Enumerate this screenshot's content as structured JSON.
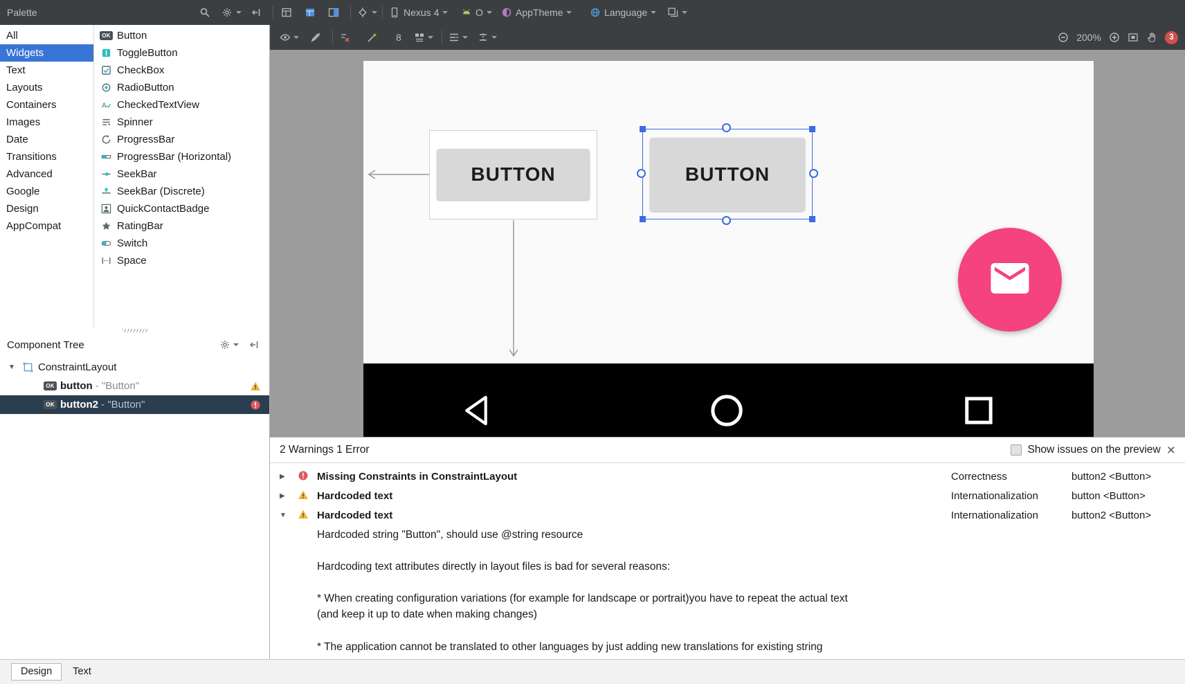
{
  "top_toolbar": {
    "palette_label": "Palette",
    "device_label": "Nexus 4",
    "api_label": "O",
    "theme_label": "AppTheme",
    "language_label": "Language"
  },
  "design_toolbar": {
    "default_margin": "8",
    "zoom_level": "200%",
    "issue_count": "3"
  },
  "palette": {
    "categories": [
      {
        "label": "All"
      },
      {
        "label": "Widgets"
      },
      {
        "label": "Text"
      },
      {
        "label": "Layouts"
      },
      {
        "label": "Containers"
      },
      {
        "label": "Images"
      },
      {
        "label": "Date"
      },
      {
        "label": "Transitions"
      },
      {
        "label": "Advanced"
      },
      {
        "label": "Google"
      },
      {
        "label": "Design"
      },
      {
        "label": "AppCompat"
      }
    ],
    "widgets": [
      {
        "label": "Button"
      },
      {
        "label": "ToggleButton"
      },
      {
        "label": "CheckBox"
      },
      {
        "label": "RadioButton"
      },
      {
        "label": "CheckedTextView"
      },
      {
        "label": "Spinner"
      },
      {
        "label": "ProgressBar"
      },
      {
        "label": "ProgressBar (Horizontal)"
      },
      {
        "label": "SeekBar"
      },
      {
        "label": "SeekBar (Discrete)"
      },
      {
        "label": "QuickContactBadge"
      },
      {
        "label": "RatingBar"
      },
      {
        "label": "Switch"
      },
      {
        "label": "Space"
      }
    ]
  },
  "component_tree": {
    "title": "Component Tree",
    "nodes": [
      {
        "name": "ConstraintLayout",
        "suffix": ""
      },
      {
        "name": "button",
        "suffix": " - \"Button\""
      },
      {
        "name": "button2",
        "suffix": " - \"Button\""
      }
    ]
  },
  "canvas": {
    "button1_label": "BUTTON",
    "button2_label": "BUTTON"
  },
  "issues": {
    "summary": "2 Warnings 1 Error",
    "show_on_preview_label": "Show issues on the preview",
    "rows": [
      {
        "title": "Missing Constraints in ConstraintLayout",
        "category": "Correctness",
        "component": "button2 <Button>"
      },
      {
        "title": "Hardcoded text",
        "category": "Internationalization",
        "component": "button <Button>"
      },
      {
        "title": "Hardcoded text",
        "category": "Internationalization",
        "component": "button2 <Button>"
      }
    ],
    "detail": {
      "line1": "Hardcoded string \"Button\", should use @string resource",
      "line2": "Hardcoding text attributes directly in layout files is bad for several reasons:",
      "line3a": "* When creating configuration variations (for example for landscape or portrait)you have to repeat the actual text",
      "line3b": "(and keep it up to date when making changes)",
      "line4": "* The application cannot be translated to other languages by just adding new translations for existing string"
    }
  },
  "bottom_tabs": [
    {
      "label": "Design"
    },
    {
      "label": "Text"
    }
  ],
  "icons": {
    "ok_badge": "OK",
    "expand_open_glyph": "▼",
    "expand_closed_glyph": "▶",
    "close_glyph": "×",
    "letter_a_glyph": "A"
  },
  "colors": {
    "toolbar_bg": "#3c3f41",
    "selection_blue": "#3875d6",
    "constraint_blue": "#3d6be4",
    "fab_pink": "#f4437f",
    "error_red": "#dd5a62",
    "warning_yellow": "#f2b63c",
    "canvas_gray": "#9c9c9c"
  }
}
